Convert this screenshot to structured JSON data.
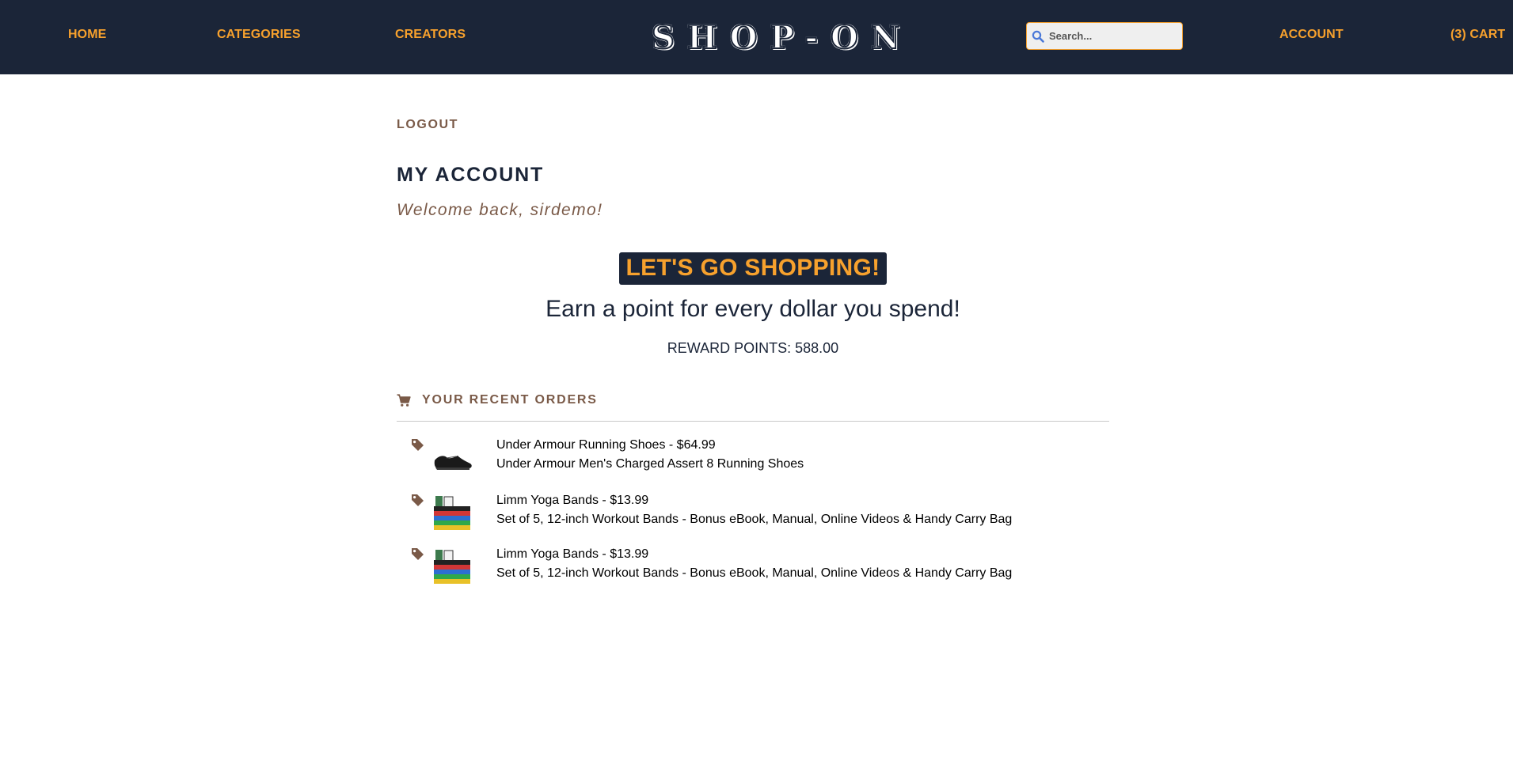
{
  "nav": {
    "home": "HOME",
    "categories": "CATEGORIES",
    "creators": "CREATORS",
    "logo": "SHOP-ON",
    "search_placeholder": "Search...",
    "account": "ACCOUNT",
    "cart": "(3) CART"
  },
  "account": {
    "logout": "LOGOUT",
    "title": "MY ACCOUNT",
    "welcome": "Welcome back, sirdemo!"
  },
  "promo": {
    "badge": "LET'S GO SHOPPING!",
    "subtitle": "Earn a point for every dollar you spend!",
    "rewards": "REWARD POINTS: 588.00"
  },
  "orders": {
    "title": "YOUR RECENT ORDERS",
    "items": [
      {
        "name": "Under Armour Running Shoes - $64.99",
        "description": "Under Armour Men's Charged Assert 8 Running Shoes",
        "thumb": "shoe"
      },
      {
        "name": "Limm Yoga Bands - $13.99",
        "description": "Set of 5, 12-inch Workout Bands - Bonus eBook, Manual, Online Videos & Handy Carry Bag",
        "thumb": "bands"
      },
      {
        "name": "Limm Yoga Bands - $13.99",
        "description": "Set of 5, 12-inch Workout Bands - Bonus eBook, Manual, Online Videos & Handy Carry Bag",
        "thumb": "bands"
      }
    ]
  },
  "colors": {
    "navy": "#1b2538",
    "accent": "#f7a12d",
    "brown": "#7a5a48"
  },
  "icons": {
    "search": "search-icon",
    "cart": "cart-icon",
    "tag": "tag-icon"
  }
}
